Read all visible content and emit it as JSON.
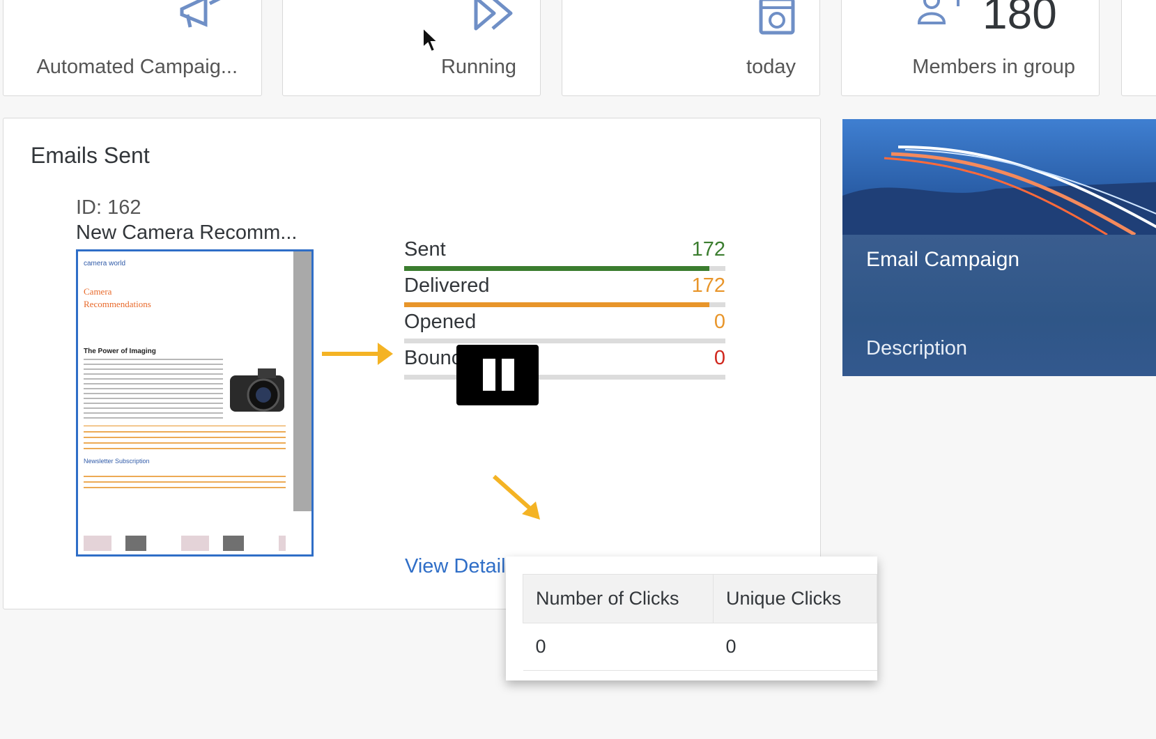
{
  "tiles": [
    {
      "label": "Automated Campaig...",
      "icon": "megaphone-icon"
    },
    {
      "label": "Running",
      "icon": "fast-forward-icon"
    },
    {
      "label": "today",
      "icon": "calendar-sync-icon"
    },
    {
      "label": "Members in group",
      "icon": "group-members-icon",
      "number": "180"
    }
  ],
  "emails_card": {
    "title": "Emails Sent",
    "email_id": "ID: 162",
    "email_name": "New Camera Recomm...",
    "preview": {
      "brand": "camera world",
      "headline_line1": "Camera",
      "headline_line2": "Recommendations",
      "subhead": "The Power of Imaging",
      "link1": "Newsletter Subscription"
    },
    "view_details": "View Details"
  },
  "stats": [
    {
      "name": "Sent",
      "value": "172",
      "color": "#3b7d2f",
      "fill": 0.95
    },
    {
      "name": "Delivered",
      "value": "172",
      "color": "#e8952a",
      "fill": 0.95
    },
    {
      "name": "Opened",
      "value": "0",
      "color": "#e8952a",
      "fill": 0
    },
    {
      "name": "Bounced",
      "value": "0",
      "color": "#d0271d",
      "fill": 0
    }
  ],
  "campaign_card": {
    "title": "Email Campaign",
    "description": "Description"
  },
  "clicks_popover": {
    "headers": [
      "Number of Clicks",
      "Unique Clicks"
    ],
    "values": [
      "0",
      "0"
    ]
  },
  "colors": {
    "accent": "#2f6ec7",
    "arrow": "#f4b324"
  }
}
